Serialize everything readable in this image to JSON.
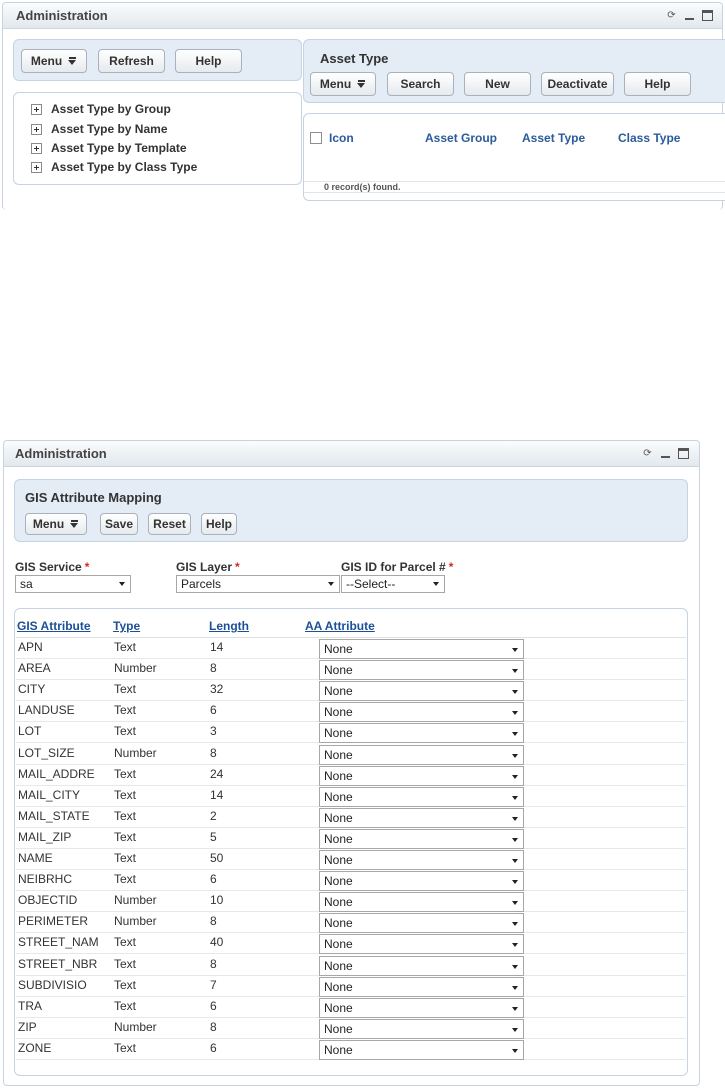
{
  "window1": {
    "title": "Administration",
    "left_toolbar": {
      "menu": "Menu",
      "refresh": "Refresh",
      "help": "Help"
    },
    "tree": [
      "Asset Type by Group",
      "Asset Type by Name",
      "Asset Type by Template",
      "Asset Type by Class Type"
    ],
    "asset_type": {
      "heading": "Asset Type",
      "buttons": {
        "menu": "Menu",
        "search": "Search",
        "new": "New",
        "deactivate": "Deactivate",
        "help": "Help"
      },
      "columns": [
        "Icon",
        "Asset Group",
        "Asset Type",
        "Class Type"
      ],
      "record_count": "0 record(s) found."
    }
  },
  "window2": {
    "title": "Administration",
    "panel_heading": "GIS Attribute Mapping",
    "buttons": {
      "menu": "Menu",
      "save": "Save",
      "reset": "Reset",
      "help": "Help"
    },
    "fields": {
      "gis_service": {
        "label": "GIS Service",
        "value": "sa"
      },
      "gis_layer": {
        "label": "GIS Layer",
        "value": "Parcels"
      },
      "gis_id": {
        "label": "GIS ID for Parcel #",
        "value": "--Select--"
      }
    },
    "required_mark": "*",
    "columns": [
      "GIS Attribute",
      "Type",
      "Length",
      "AA Attribute"
    ],
    "rows": [
      {
        "attribute": "APN",
        "type": "Text",
        "length": "14",
        "aa": "None"
      },
      {
        "attribute": "AREA",
        "type": "Number",
        "length": "8",
        "aa": "None"
      },
      {
        "attribute": "CITY",
        "type": "Text",
        "length": "32",
        "aa": "None"
      },
      {
        "attribute": "LANDUSE",
        "type": "Text",
        "length": "6",
        "aa": "None"
      },
      {
        "attribute": "LOT",
        "type": "Text",
        "length": "3",
        "aa": "None"
      },
      {
        "attribute": "LOT_SIZE",
        "type": "Number",
        "length": "8",
        "aa": "None"
      },
      {
        "attribute": "MAIL_ADDRE",
        "type": "Text",
        "length": "24",
        "aa": "None"
      },
      {
        "attribute": "MAIL_CITY",
        "type": "Text",
        "length": "14",
        "aa": "None"
      },
      {
        "attribute": "MAIL_STATE",
        "type": "Text",
        "length": "2",
        "aa": "None"
      },
      {
        "attribute": "MAIL_ZIP",
        "type": "Text",
        "length": "5",
        "aa": "None"
      },
      {
        "attribute": "NAME",
        "type": "Text",
        "length": "50",
        "aa": "None"
      },
      {
        "attribute": "NEIBRHC",
        "type": "Text",
        "length": "6",
        "aa": "None"
      },
      {
        "attribute": "OBJECTID",
        "type": "Number",
        "length": "10",
        "aa": "None"
      },
      {
        "attribute": "PERIMETER",
        "type": "Number",
        "length": "8",
        "aa": "None"
      },
      {
        "attribute": "STREET_NAM",
        "type": "Text",
        "length": "40",
        "aa": "None"
      },
      {
        "attribute": "STREET_NBR",
        "type": "Text",
        "length": "8",
        "aa": "None"
      },
      {
        "attribute": "SUBDIVISIO",
        "type": "Text",
        "length": "7",
        "aa": "None"
      },
      {
        "attribute": "TRA",
        "type": "Text",
        "length": "6",
        "aa": "None"
      },
      {
        "attribute": "ZIP",
        "type": "Number",
        "length": "8",
        "aa": "None"
      },
      {
        "attribute": "ZONE",
        "type": "Text",
        "length": "6",
        "aa": "None"
      }
    ]
  }
}
